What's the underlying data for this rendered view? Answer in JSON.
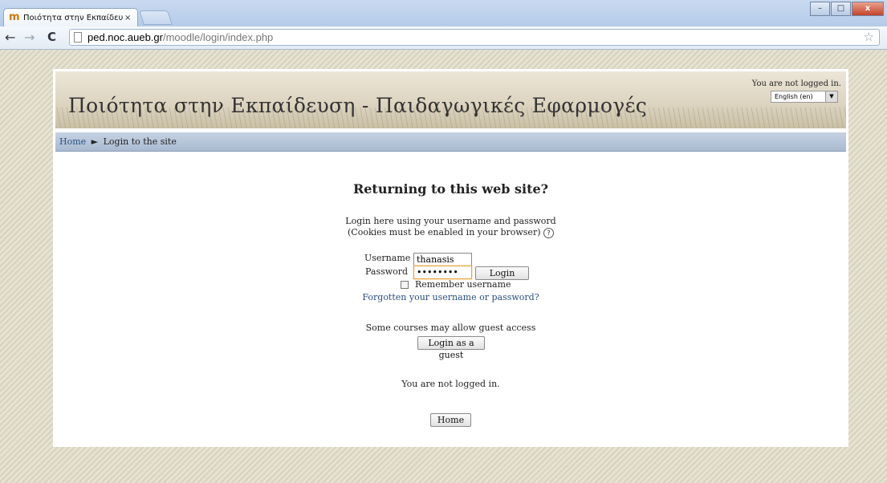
{
  "browser": {
    "tab_title": "Ποιότητα στην Εκπαίδευ",
    "tab_close": "×",
    "url_host": "ped.noc.aueb.gr",
    "url_path": "/moodle/login/index.php",
    "back_icon": "←",
    "forward_icon": "→",
    "reload_icon": "C",
    "star_icon": "☆",
    "min_label": "–",
    "max_label": "□",
    "close_label": "x"
  },
  "header": {
    "site_title": "Ποιότητα στην Εκπαίδευση - Παιδαγωγικές Εφαρμογές",
    "login_info": "You are not logged in.",
    "language": "English (en)",
    "lang_arrow": "▼"
  },
  "breadcrumb": {
    "home": "Home",
    "separator": "►",
    "current": "Login to the site"
  },
  "login": {
    "heading": "Returning to this web site?",
    "intro_line1": "Login here using your username and password",
    "intro_line2": "(Cookies must be enabled in your browser)",
    "help_icon": "?",
    "username_label": "Username",
    "username_value": "thanasis",
    "password_label": "Password",
    "password_value": "••••••••",
    "login_button": "Login",
    "remember_label": "Remember username",
    "forgot_link": "Forgotten your username or password?",
    "guest_text": "Some courses may allow guest access",
    "guest_button": "Login as a guest",
    "footer_status": "You are not logged in.",
    "home_button": "Home"
  }
}
